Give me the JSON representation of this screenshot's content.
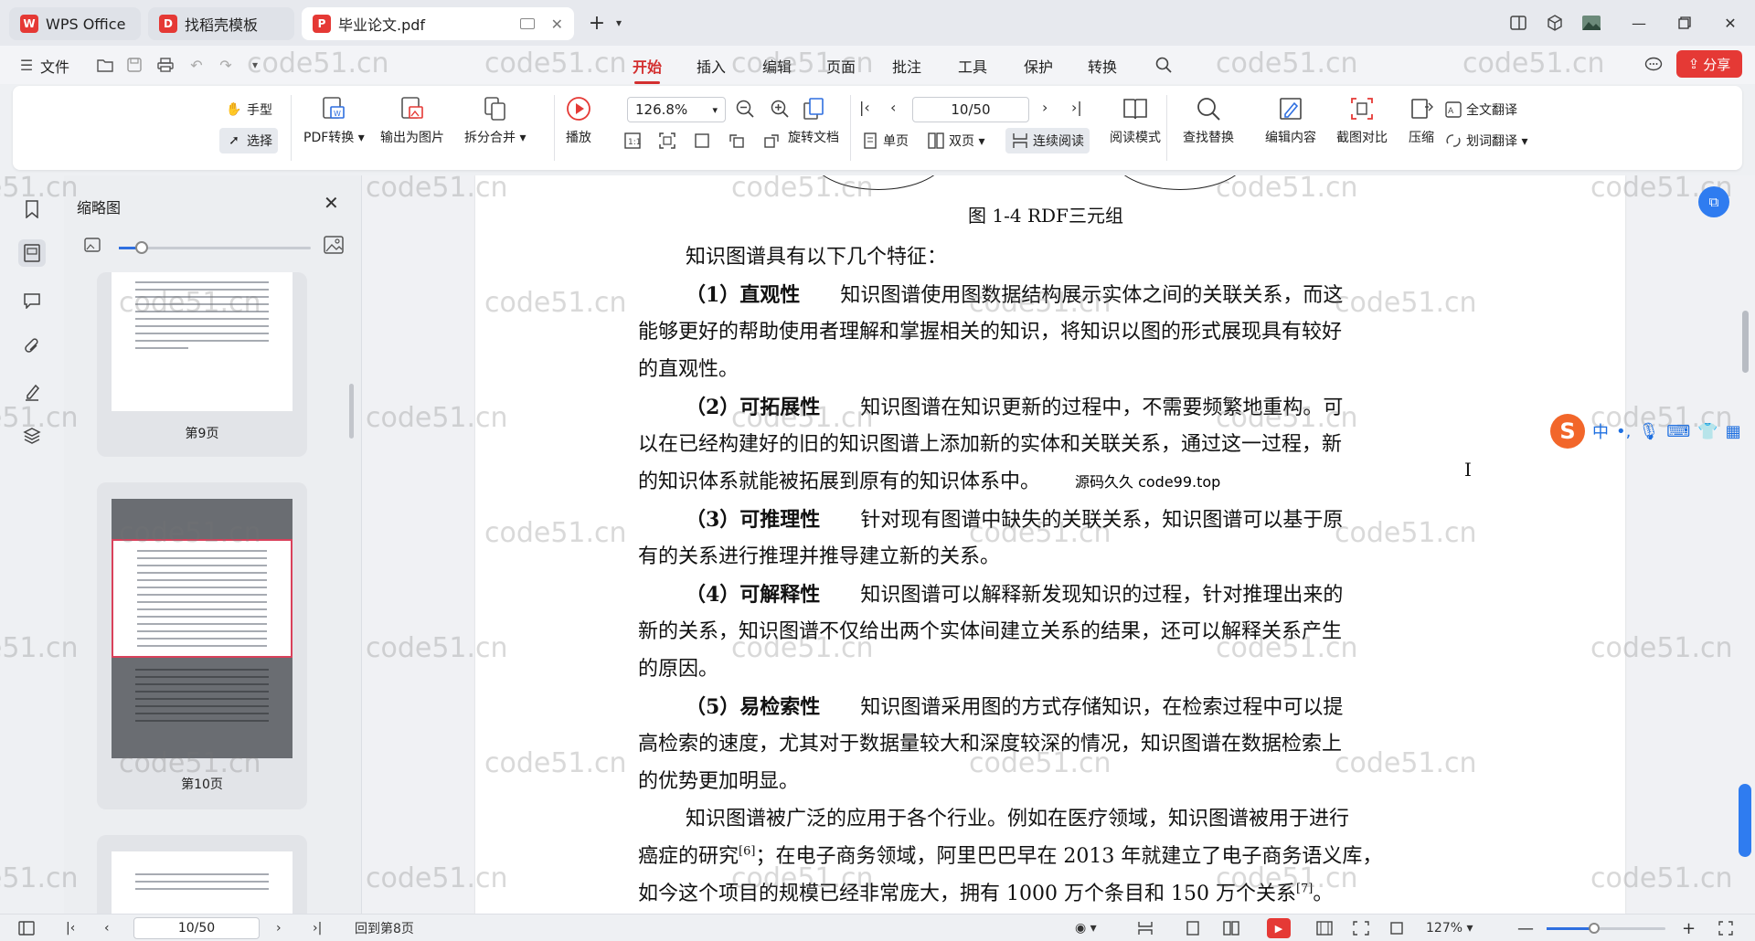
{
  "tabs": [
    {
      "label": "WPS Office",
      "icon": "wps-logo-icon",
      "color": "#e53935"
    },
    {
      "label": "找稻壳模板",
      "icon": "docer-icon",
      "color": "#e53935"
    },
    {
      "label": "毕业论文.pdf",
      "icon": "pdf-icon",
      "color": "#e53935"
    }
  ],
  "menu": {
    "file": "文件",
    "items": [
      "开始",
      "插入",
      "编辑",
      "页面",
      "批注",
      "工具",
      "保护",
      "转换"
    ],
    "active": "开始",
    "share": "分享"
  },
  "ribbon": {
    "hand": "手型",
    "select": "选择",
    "pdf_convert": "PDF转换",
    "export_image": "输出为图片",
    "split_merge": "拆分合并",
    "play": "播放",
    "zoom": "126.8%",
    "rotate": "旋转文档",
    "page_input": "10/50",
    "single": "单页",
    "double": "双页",
    "continuous": "连续阅读",
    "read_mode": "阅读模式",
    "find_replace": "查找替换",
    "edit_content": "编辑内容",
    "screenshot_compare": "截图对比",
    "compress": "压缩",
    "full_translate": "全文翻译",
    "word_translate": "划词翻译"
  },
  "thumbnails": {
    "title": "缩略图",
    "zoom_level": 0.12,
    "pages": [
      "第9页",
      "第10页"
    ]
  },
  "document": {
    "caption": "图 1-4 RDF三元组",
    "stamp": "源码久久 code99.top",
    "lines": [
      {
        "indent": 2,
        "bold": "",
        "text": "知识图谱具有以下几个特征："
      },
      {
        "indent": 2,
        "bold": "（1）直观性",
        "text": "　　知识图谱使用图数据结构展示实体之间的关联关系，而这"
      },
      {
        "indent": 0,
        "bold": "",
        "text": "能够更好的帮助使用者理解和掌握相关的知识，将知识以图的形式展现具有较好"
      },
      {
        "indent": 0,
        "bold": "",
        "text": "的直观性。"
      },
      {
        "indent": 2,
        "bold": "（2）可拓展性",
        "text": "　　知识图谱在知识更新的过程中，不需要频繁地重构。可"
      },
      {
        "indent": 0,
        "bold": "",
        "text": "以在已经构建好的旧的知识图谱上添加新的实体和关联关系，通过这一过程，新"
      },
      {
        "indent": 0,
        "bold": "",
        "text": "的知识体系就能被拓展到原有的知识体系中。"
      },
      {
        "indent": 2,
        "bold": "（3）可推理性",
        "text": "　　针对现有图谱中缺失的关联关系，知识图谱可以基于原"
      },
      {
        "indent": 0,
        "bold": "",
        "text": "有的关系进行推理并推导建立新的关系。"
      },
      {
        "indent": 2,
        "bold": "（4）可解释性",
        "text": "　　知识图谱可以解释新发现知识的过程，针对推理出来的"
      },
      {
        "indent": 0,
        "bold": "",
        "text": "新的关系，知识图谱不仅给出两个实体间建立关系的结果，还可以解释关系产生"
      },
      {
        "indent": 0,
        "bold": "",
        "text": "的原因。"
      },
      {
        "indent": 2,
        "bold": "（5）易检索性",
        "text": "　　知识图谱采用图的方式存储知识，在检索过程中可以提"
      },
      {
        "indent": 0,
        "bold": "",
        "text": "高检索的速度，尤其对于数据量较大和深度较深的情况，知识图谱在数据检索上"
      },
      {
        "indent": 0,
        "bold": "",
        "text": "的优势更加明显。"
      },
      {
        "indent": 2,
        "bold": "",
        "text": "知识图谱被广泛的应用于各个行业。例如在医疗领域，知识图谱被用于进行"
      },
      {
        "indent": 0,
        "bold": "",
        "text": "癌症的研究",
        "sup": "[6]",
        "after": "；在电子商务领域，阿里巴巴早在 2013 年就建立了电子商务语义库，"
      },
      {
        "indent": 0,
        "bold": "",
        "text": "如今这个项目的规模已经非常庞大，拥有 1000 万个条目和 150 万个关系",
        "sup": "[7]",
        "after": "。"
      }
    ]
  },
  "ime": {
    "lang": "中",
    "punct": "•,",
    "mic": "mic-icon",
    "keyboard": "keyboard-icon",
    "skin": "shirt-icon",
    "grid": "grid-icon"
  },
  "watermark": "code51.cn",
  "status": {
    "page": "10/50",
    "back_to": "回到第8页",
    "zoom": "127%",
    "zoom_level": 0.4
  },
  "colors": {
    "accent": "#d32f2f",
    "brand": "#e53935",
    "blue": "#2f7cf0"
  }
}
